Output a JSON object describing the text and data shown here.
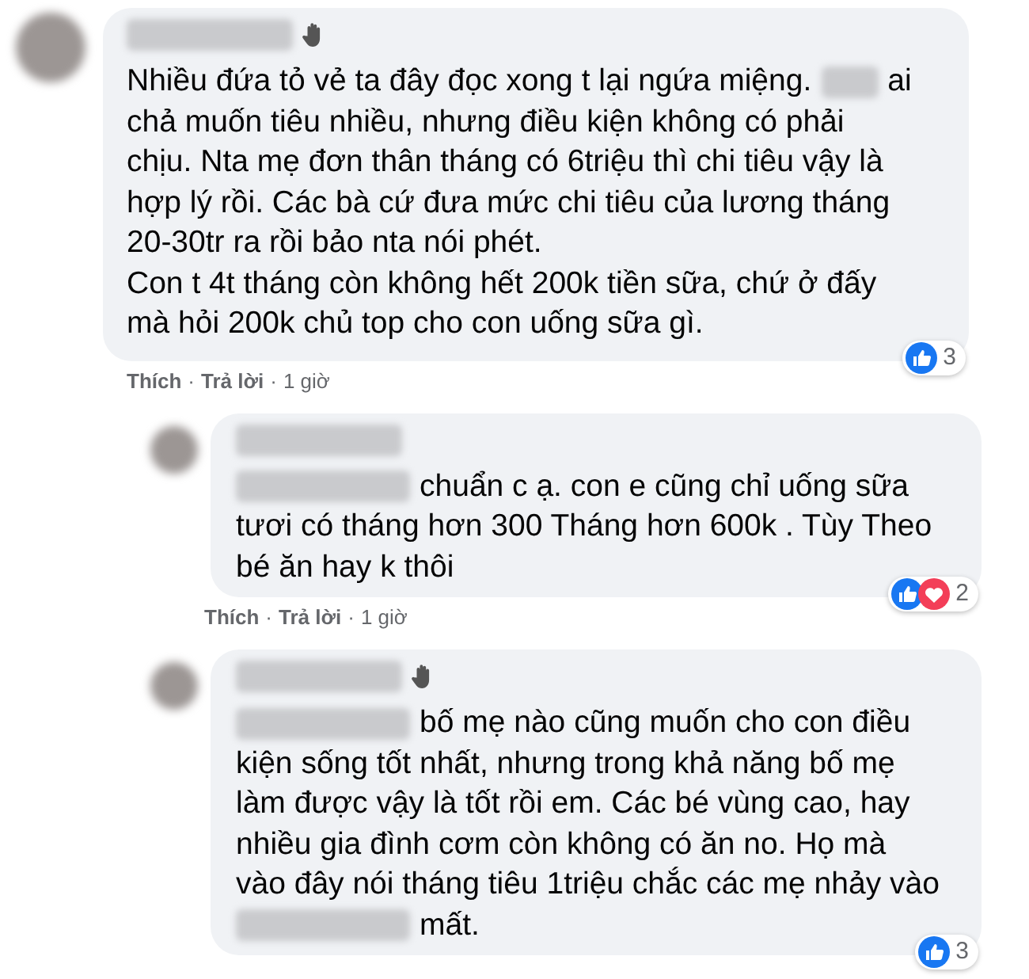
{
  "comments": [
    {
      "badge": true,
      "lines": [
        [
          {
            "kind": "text",
            "text": "Nhiều đứa tỏ vẻ ta đây đọc xong t lại ngứa miệng."
          },
          {
            "kind": "blur"
          },
          {
            "kind": "text",
            "text": "ai"
          }
        ],
        [
          {
            "kind": "text",
            "text": "chả muốn tiêu nhiều, nhưng điều kiện không có phải"
          }
        ],
        [
          {
            "kind": "text",
            "text": "chịu. Nta mẹ đơn thân tháng có 6triệu thì chi tiêu vậy là"
          }
        ],
        [
          {
            "kind": "text",
            "text": "hợp lý rồi. Các bà cứ đưa mức chi tiêu của lương tháng"
          }
        ],
        [
          {
            "kind": "text",
            "text": "20-30tr ra rồi bảo nta nói phét."
          }
        ],
        [
          {
            "kind": "text",
            "text": "Con t 4t tháng còn không hết 200k tiền sữa, chứ ở đấy"
          }
        ],
        [
          {
            "kind": "text",
            "text": "mà hỏi 200k chủ top cho con uống sữa gì."
          }
        ]
      ],
      "actions": {
        "like": "Thích",
        "reply": "Trả lời",
        "time": "1 giờ",
        "separator": "·"
      },
      "reactions": {
        "icons": [
          {
            "kind": "like"
          }
        ],
        "count": "3"
      },
      "children": [
        {
          "badge": false,
          "lines": [
            [
              {
                "kind": "blur"
              },
              {
                "kind": "text",
                "text": "chuẩn c ạ. con e cũng chỉ uống sữa"
              }
            ],
            [
              {
                "kind": "text",
                "text": "tươi có tháng hơn 300 Tháng hơn 600k . Tùy Theo"
              }
            ],
            [
              {
                "kind": "text",
                "text": "bé ăn hay k thôi"
              }
            ]
          ],
          "actions": {
            "like": "Thích",
            "reply": "Trả lời",
            "time": "1 giờ",
            "separator": "·"
          },
          "reactions": {
            "icons": [
              {
                "kind": "like"
              },
              {
                "kind": "love"
              }
            ],
            "count": "2"
          }
        },
        {
          "badge": true,
          "lines": [
            [
              {
                "kind": "blur"
              },
              {
                "kind": "text",
                "text": "bố mẹ nào cũng muốn cho con điều"
              }
            ],
            [
              {
                "kind": "text",
                "text": "kiện sống tốt nhất, nhưng trong khả năng bố mẹ"
              }
            ],
            [
              {
                "kind": "text",
                "text": "làm được vậy là tốt rồi em. Các bé vùng cao, hay"
              }
            ],
            [
              {
                "kind": "text",
                "text": "nhiều gia đình cơm còn không có ăn no. Họ mà"
              }
            ],
            [
              {
                "kind": "text",
                "text": "vào đây nói tháng tiêu 1triệu chắc các mẹ nhảy vào"
              }
            ],
            [
              {
                "kind": "blur"
              },
              {
                "kind": "text",
                "text": "mất."
              }
            ]
          ],
          "reactions": {
            "icons": [
              {
                "kind": "like"
              }
            ],
            "count": "3"
          }
        }
      ]
    }
  ]
}
